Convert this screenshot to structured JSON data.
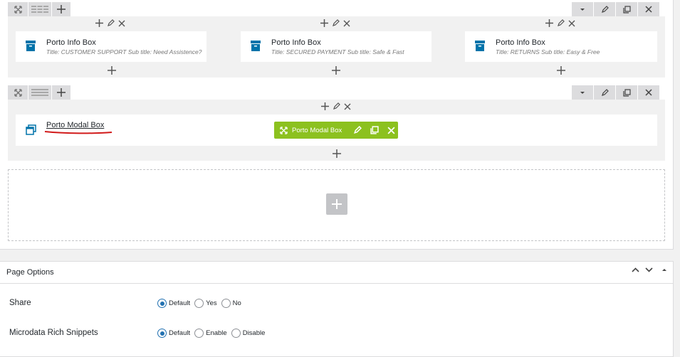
{
  "row1": {
    "columns": [
      {
        "element": {
          "title": "Porto Info Box",
          "subtitle": "Title: CUSTOMER SUPPORT  Sub title: Need Assistence?"
        }
      },
      {
        "element": {
          "title": "Porto Info Box",
          "subtitle": "Title: SECURED PAYMENT  Sub title: Safe & Fast"
        }
      },
      {
        "element": {
          "title": "Porto Info Box",
          "subtitle": "Title: RETURNS  Sub title: Easy & Free"
        }
      }
    ]
  },
  "row2": {
    "element": {
      "title": "Porto Modal Box"
    },
    "toolbar": {
      "label": "Porto Modal Box"
    }
  },
  "page_options": {
    "title": "Page Options",
    "options": [
      {
        "label": "Share",
        "choices": [
          "Default",
          "Yes",
          "No"
        ],
        "selected": "Default"
      },
      {
        "label": "Microdata Rich Snippets",
        "choices": [
          "Default",
          "Enable",
          "Disable"
        ],
        "selected": "Default"
      }
    ]
  },
  "colors": {
    "accent_green": "#8cc11f",
    "icon_blue": "#0073aa",
    "underline_red": "#d11a1a",
    "radio_blue": "#2271b1"
  }
}
